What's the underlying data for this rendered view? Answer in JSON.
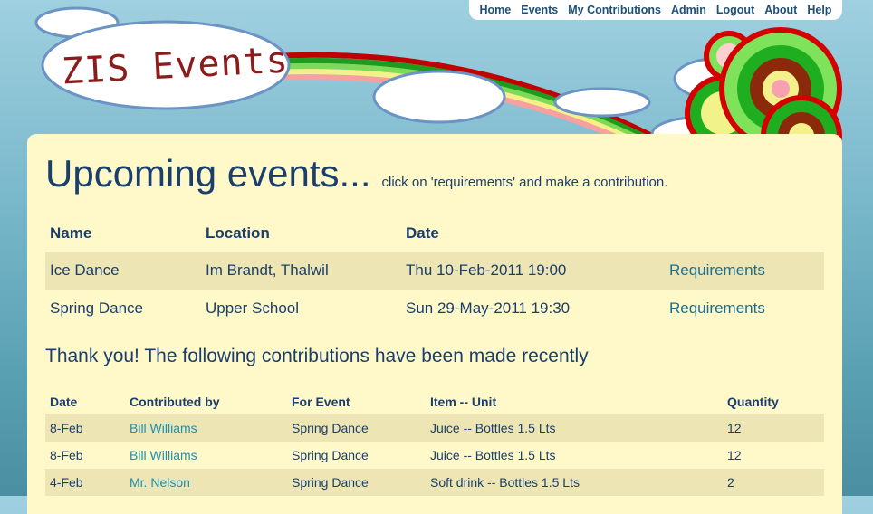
{
  "site": {
    "logo_text": "ZIS Events"
  },
  "nav": {
    "items": [
      "Home",
      "Events",
      "My Contributions",
      "Admin",
      "Logout",
      "About",
      "Help"
    ]
  },
  "heading": {
    "title": "Upcoming events...",
    "hint": "click on 'requirements' and make a contribution."
  },
  "events_table": {
    "headers": [
      "Name",
      "Location",
      "Date",
      ""
    ],
    "rows": [
      {
        "name": "Ice Dance",
        "location": "Im Brandt, Thalwil",
        "date": "Thu 10-Feb-2011 19:00",
        "link": "Requirements"
      },
      {
        "name": "Spring Dance",
        "location": "Upper School",
        "date": "Sun 29-May-2011 19:30",
        "link": "Requirements"
      }
    ]
  },
  "thanks_text": "Thank you! The following contributions have been made recently",
  "contributions_table": {
    "headers": [
      "Date",
      "Contributed by",
      "For Event",
      "Item -- Unit",
      "Quantity"
    ],
    "rows": [
      {
        "date": "8-Feb",
        "by": "Bill Williams",
        "event": "Spring Dance",
        "item": "Juice -- Bottles 1.5 Lts",
        "qty": "12"
      },
      {
        "date": "8-Feb",
        "by": "Bill Williams",
        "event": "Spring Dance",
        "item": "Juice -- Bottles 1.5 Lts",
        "qty": "12"
      },
      {
        "date": "4-Feb",
        "by": "Mr. Nelson",
        "event": "Spring Dance",
        "item": "Soft drink -- Bottles 1.5 Lts",
        "qty": "2"
      }
    ]
  },
  "colors": {
    "panel": "#fff8c9",
    "row_alt": "#ede5b4",
    "text": "#1b3f6c",
    "link": "#1d8fb0"
  }
}
